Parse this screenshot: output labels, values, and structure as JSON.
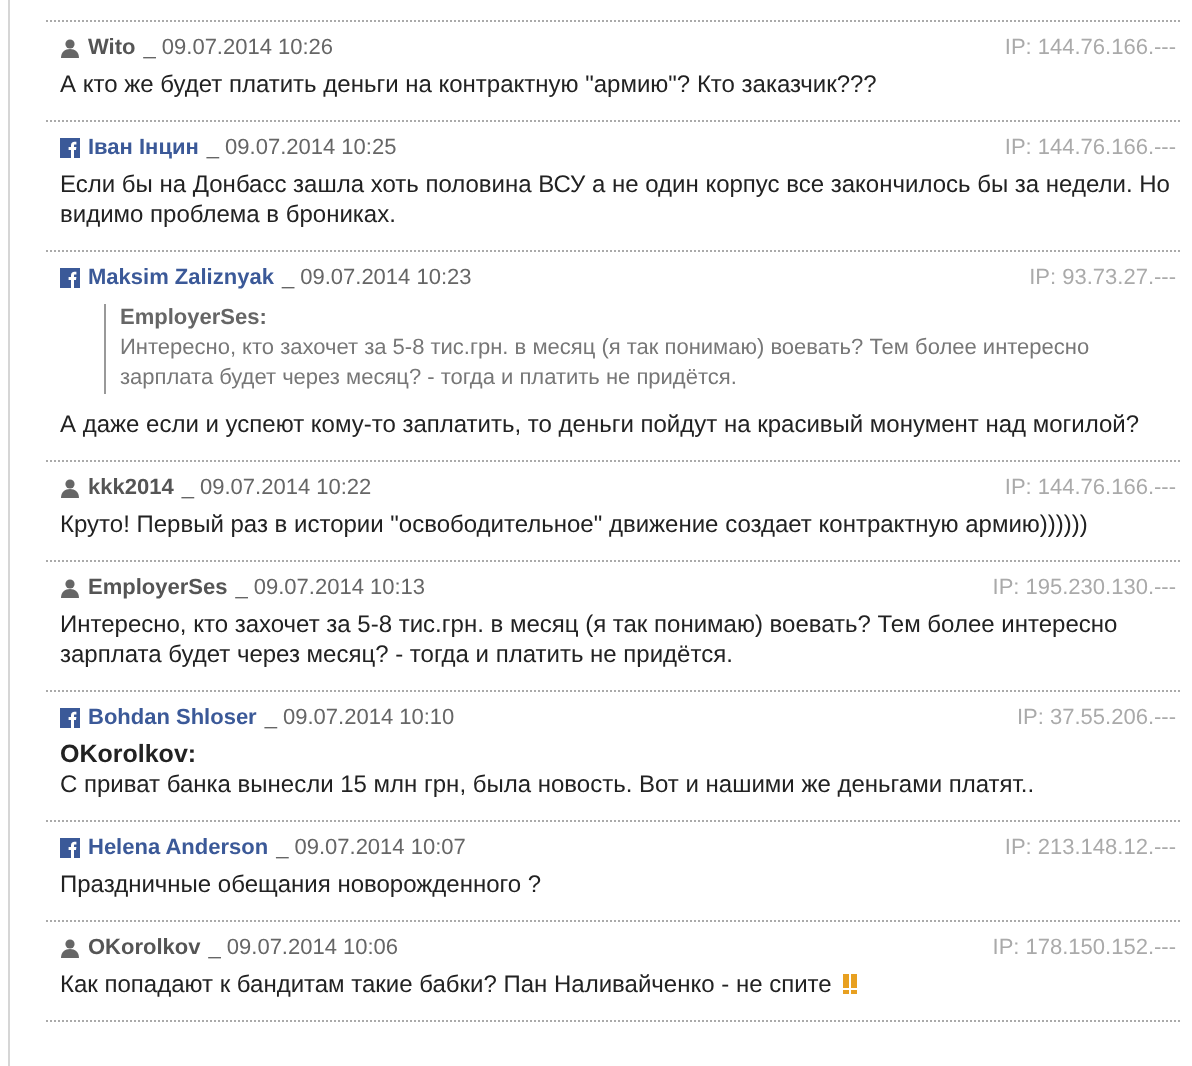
{
  "comments": [
    {
      "kind": "site",
      "author": "Wito",
      "time": "_ 09.07.2014 10:26",
      "ip": "IP: 144.76.166.---",
      "text": "А кто же будет платить деньги на контрактную \"армию\"? Кто заказчик???"
    },
    {
      "kind": "facebook",
      "author": "Іван Інцин",
      "time": "_ 09.07.2014 10:25",
      "ip": "IP: 144.76.166.---",
      "text": "Если бы на Донбасс зашла хоть половина ВСУ а не один корпус все закончилось бы за недели. Но видимо проблема в брониках."
    },
    {
      "kind": "facebook",
      "author": "Maksim Zaliznyak",
      "time": "_ 09.07.2014 10:23",
      "ip": "IP: 93.73.27.---",
      "quote": {
        "author": "EmployerSes:",
        "text": "Интересно, кто захочет за 5-8 тис.грн. в месяц (я так понимаю) воевать? Тем более интересно зарплата будет через месяц? - тогда и платить не придётся."
      },
      "text": "А даже если и успеют кому-то заплатить, то деньги пойдут на красивый монумент над могилой?"
    },
    {
      "kind": "site",
      "author": "kkk2014",
      "time": "_ 09.07.2014 10:22",
      "ip": "IP: 144.76.166.---",
      "text": "Круто! Первый раз в истории \"освободительное\" движение создает контрактную армию))))))"
    },
    {
      "kind": "site",
      "author": "EmployerSes",
      "time": "_ 09.07.2014 10:13",
      "ip": "IP: 195.230.130.---",
      "text": "Интересно, кто захочет за 5-8 тис.грн. в месяц (я так понимаю) воевать? Тем более интересно зарплата будет через месяц? - тогда и платить не придётся."
    },
    {
      "kind": "facebook",
      "author": "Bohdan Shloser",
      "time": "_ 09.07.2014 10:10",
      "ip": "IP: 37.55.206.---",
      "reply_to": "OKorolkov:",
      "text": "С приват банка вынесли 15 млн грн, была новость. Вот и нашими же деньгами платят.."
    },
    {
      "kind": "facebook",
      "author": "Helena Anderson",
      "time": "_ 09.07.2014 10:07",
      "ip": "IP: 213.148.12.---",
      "text": "Праздничные обещания новорожденного ?"
    },
    {
      "kind": "site",
      "author": "OKorolkov",
      "time": "_ 09.07.2014 10:06",
      "ip": "IP: 178.150.152.---",
      "text": "Как попадают к бандитам такие бабки? Пан Наливайченко - не спите",
      "emoji": true
    }
  ]
}
